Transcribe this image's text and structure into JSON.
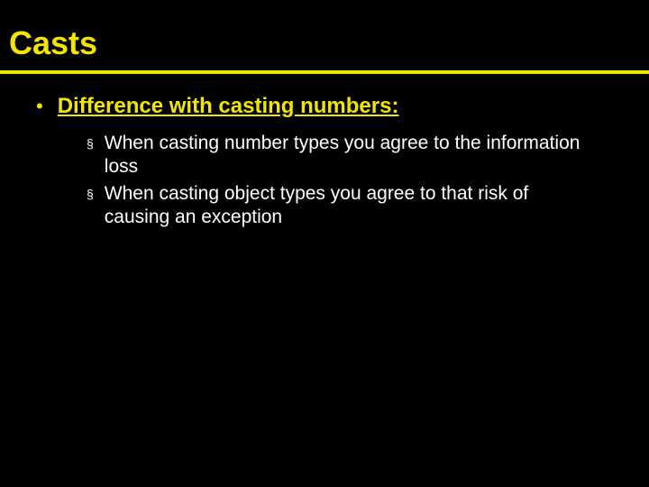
{
  "slide": {
    "title": "Casts",
    "heading": {
      "bullet": "•",
      "text": "Difference with casting numbers:"
    },
    "points": [
      {
        "bullet": "§",
        "text": "When casting number types you agree to the information loss"
      },
      {
        "bullet": "§",
        "text": "When casting object types you agree to that risk of causing an exception"
      }
    ]
  }
}
